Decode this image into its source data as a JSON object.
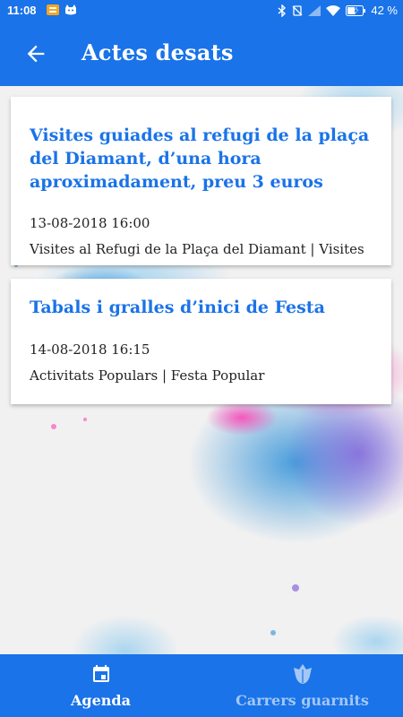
{
  "status_bar": {
    "time": "11:08",
    "battery_percent": "42 %"
  },
  "app_bar": {
    "title": "Actes desats"
  },
  "events": [
    {
      "title": "Visites guiades al refugi de la plaça del Diamant, d’una hora aproximadament, preu 3 euros",
      "datetime": "13-08-2018 16:00",
      "category": "Visites al Refugi de la Plaça del Diamant | Visites"
    },
    {
      "title": "Tabals i gralles d’inici de Festa",
      "datetime": "14-08-2018 16:15",
      "category": "Activitats Populars | Festa Popular"
    }
  ],
  "bottom_nav": {
    "items": [
      {
        "label": "Agenda",
        "icon": "calendar-icon",
        "active": true
      },
      {
        "label": "Carrers guarnits",
        "icon": "flower-icon",
        "active": false
      }
    ]
  },
  "colors": {
    "primary": "#1a73e8",
    "card_title": "#1a73e8",
    "background": "#f1f1f1"
  }
}
